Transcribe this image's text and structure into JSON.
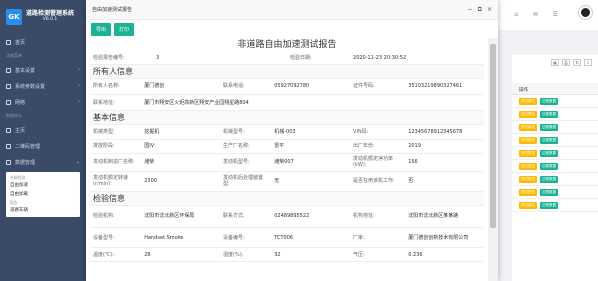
{
  "app": {
    "title": "道路检测管理系统",
    "version": "V6.0.1",
    "logo_mark": "GK"
  },
  "sidebar": {
    "home": "首页",
    "group1": "功能菜单",
    "items": [
      {
        "label": "基本设置",
        "icon": "settings-icon"
      },
      {
        "label": "系统参数设置",
        "icon": "param-icon"
      },
      {
        "label": "网络",
        "icon": "network-icon"
      }
    ],
    "group2": "数据统计",
    "items2": [
      {
        "label": "主页",
        "icon": "home-icon"
      },
      {
        "label": "二维码管理",
        "icon": "qr-icon"
      },
      {
        "label": "数据管理",
        "icon": "data-icon"
      }
    ],
    "submenu": {
      "group_a": "车辆检测",
      "a1": "自由加速",
      "a2": "自由加载",
      "group_b": "报告",
      "b1": "道路车辆"
    }
  },
  "topbar": {
    "icons": [
      "home-icon",
      "message-icon",
      "user-icon"
    ]
  },
  "right_panel": {
    "header": "操作",
    "tools": [
      "table-icon",
      "print-icon",
      "refresh-icon",
      "export-icon"
    ],
    "row_buttons": {
      "a": "测试报告",
      "b": "过程数据"
    },
    "row_count": 9
  },
  "dialog": {
    "title": "自由加速测试报告",
    "controls": [
      "minimize-icon",
      "maximize-icon",
      "close-icon"
    ],
    "btn_export": "导出",
    "btn_print": "打印",
    "report_title": "非道路自由加速测试报告",
    "report_no_label": "检验报告编号:",
    "report_no": "3",
    "date_label": "检验日期:",
    "date": "2020-11-23 20:30:52",
    "sec_owner": "所有人信息",
    "owner": [
      [
        "所有人名称:",
        "厦门德创",
        "联系电话:",
        "05927092780",
        "证件号码:",
        "35103219890327461"
      ],
      [
        "联系地址:",
        "厦门市翔安区火炬高新区翔安产业园翔星路804",
        "",
        "",
        "",
        ""
      ]
    ],
    "sec_basic": "基本信息",
    "basic": [
      [
        "机械类型:",
        "挖掘机",
        "机械型号:",
        "机械-003",
        "VIN码:",
        "12345678912345678"
      ],
      [
        "排放阶段:",
        "国IV",
        "生产厂名称:",
        "雷平",
        "出厂年份:",
        "2019"
      ],
      [
        "发动机制造厂名称:",
        "潍柴",
        "发动机型号:",
        "潍柴007",
        "发动机额定净功率(kW):",
        "156"
      ],
      [
        "发动机额定转速(r/min):",
        "2300",
        "发动机后处理装置型:",
        "无",
        "是否在用该机工作:",
        "否"
      ]
    ],
    "sec_test": "检验信息",
    "test": [
      [
        "检验机构:",
        "沈阳市沈北新区环保局",
        "联系方式:",
        "02489895522",
        "机构地址:",
        "沈阳市沈北新区某某路"
      ],
      [
        "设备型号:",
        "Handset Smoke",
        "设备编号:",
        "TCT006",
        "厂家:",
        "厦门德创创新技术有限公司"
      ],
      [
        "温度(℃):",
        "28",
        "湿度(%):",
        "32",
        "气压:",
        "0.236"
      ]
    ]
  }
}
